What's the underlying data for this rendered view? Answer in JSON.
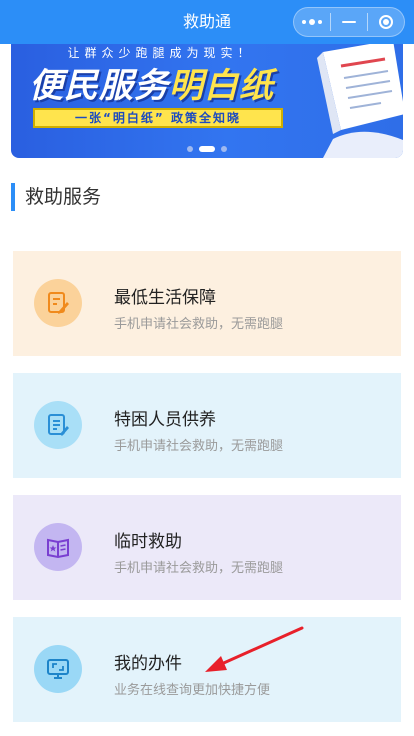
{
  "navbar": {
    "title": "救助通",
    "more_icon": "more-dots-icon",
    "minimize_icon": "minus-icon",
    "close_icon": "target-circle-icon"
  },
  "banner": {
    "top_text": "让群众少跑腿成为现实！",
    "headline_part1": "便民服务",
    "headline_part2": "明白纸",
    "strip_text": "一张“明白纸” 政策全知晓",
    "active_page": 2,
    "page_count": 3
  },
  "section": {
    "title": "救助服务"
  },
  "services": [
    {
      "title": "最低生活保障",
      "subtitle": "手机申请社会救助，无需跑腿",
      "icon": "edit-document-icon"
    },
    {
      "title": "特困人员供养",
      "subtitle": "手机申请社会救助，无需跑腿",
      "icon": "document-pen-icon"
    },
    {
      "title": "临时救助",
      "subtitle": "手机申请社会救助，无需跑腿",
      "icon": "open-book-icon"
    },
    {
      "title": "我的办件",
      "subtitle": "业务在线查询更加快捷方便",
      "icon": "monitor-icon"
    }
  ],
  "colors": {
    "accent": "#2c8ef7",
    "annotation_arrow": "#e8202a"
  }
}
